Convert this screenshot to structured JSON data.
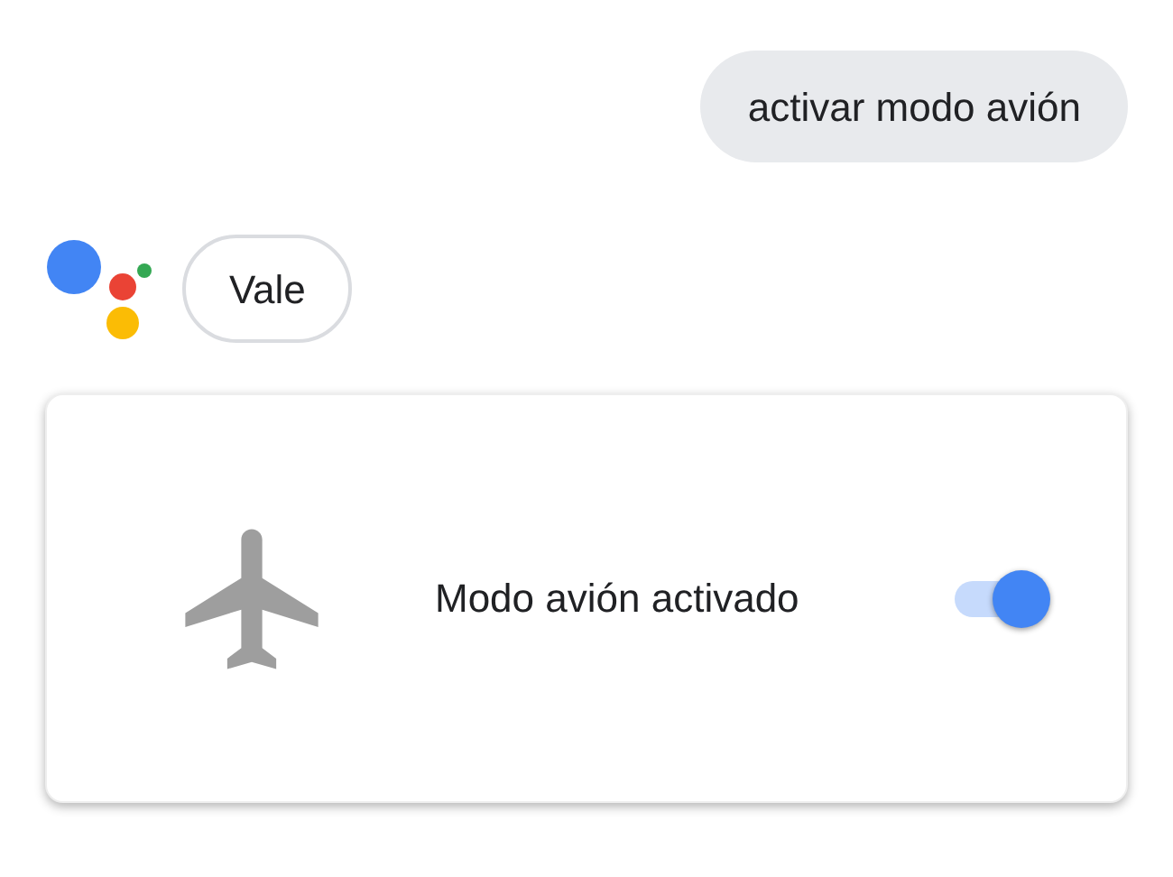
{
  "user_message": {
    "text": "activar modo avión"
  },
  "assistant_reply": {
    "text": "Vale"
  },
  "card": {
    "label": "Modo avión activado",
    "toggle": {
      "on": true
    }
  }
}
